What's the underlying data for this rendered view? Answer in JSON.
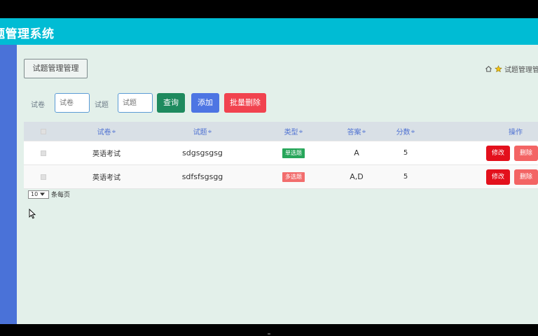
{
  "app": {
    "title": "题管理系统"
  },
  "page": {
    "title_button": "试题管理管理",
    "breadcrumb": "试题管理管"
  },
  "search": {
    "paper_label": "试卷",
    "paper_placeholder": "试卷",
    "question_label": "试题",
    "question_placeholder": "试题",
    "query_button": "查询",
    "add_button": "添加",
    "batch_delete_button": "批量删除"
  },
  "table": {
    "columns": {
      "paper": "试卷",
      "question": "试题",
      "type": "类型",
      "answer": "答案",
      "score": "分数",
      "operations": "操作"
    },
    "sort_icon": "≑",
    "rows": [
      {
        "paper": "英语考试",
        "question": "sdgsgsgsg",
        "type": "单选题",
        "answer": "A",
        "score": "5",
        "edit": "修改",
        "delete": "删除"
      },
      {
        "paper": "英语考试",
        "question": "sdfsfsgsgg",
        "type": "多选题",
        "answer": "A,D",
        "score": "5",
        "edit": "修改",
        "delete": "删除"
      }
    ]
  },
  "pager": {
    "page_size": "10",
    "per_page_label": "条每页"
  },
  "colors": {
    "topbar": "#00bcd4",
    "sidebar": "#4a72d8",
    "content_bg": "#e3f0ea",
    "query": "#1e8a5e",
    "add": "#4d75e3",
    "batch_delete": "#f1434f",
    "edit": "#e3101c",
    "delete": "#f36464",
    "tag_single": "#27a65a",
    "tag_multi": "#f26d6d"
  },
  "icons": [
    "home-icon",
    "star-icon",
    "sort-icon",
    "chevron-down-icon",
    "mouse-cursor-icon"
  ]
}
